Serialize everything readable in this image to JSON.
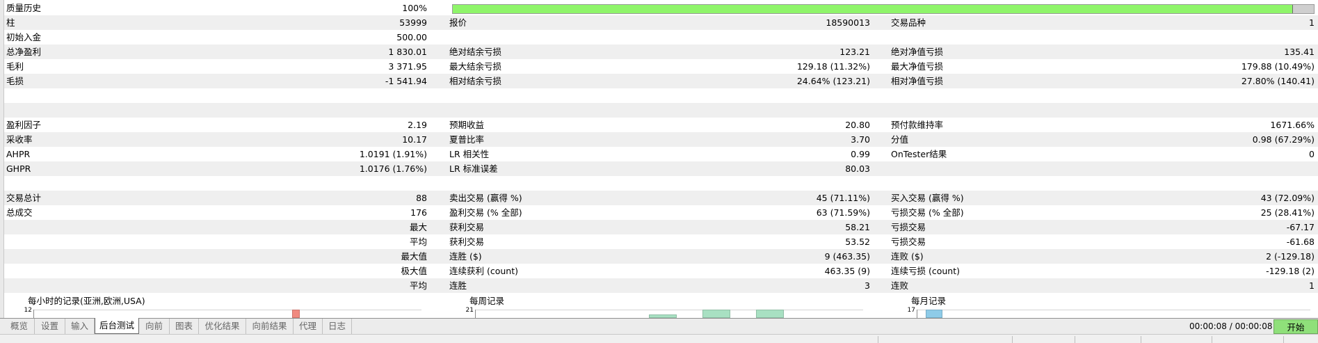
{
  "quality_row": {
    "label": "质量历史",
    "value": "100%",
    "progress": 0.976
  },
  "rows": [
    {
      "l1": "柱",
      "v1": "53999",
      "l2": "报价",
      "v2": "18590013",
      "l3": "交易品种",
      "v3": "1",
      "shade": true
    },
    {
      "l1": "初始入金",
      "v1": "500.00",
      "l2": "",
      "v2": "",
      "l3": "",
      "v3": "",
      "shade": false
    },
    {
      "l1": "总净盈利",
      "v1": "1 830.01",
      "l2": "绝对结余亏损",
      "v2": "123.21",
      "l3": "绝对净值亏损",
      "v3": "135.41",
      "shade": true
    },
    {
      "l1": "毛利",
      "v1": "3 371.95",
      "l2": "最大结余亏损",
      "v2": "129.18 (11.32%)",
      "l3": "最大净值亏损",
      "v3": "179.88 (10.49%)",
      "shade": false
    },
    {
      "l1": "毛损",
      "v1": "-1 541.94",
      "l2": "相对结余亏损",
      "v2": "24.64% (123.21)",
      "l3": "相对净值亏损",
      "v3": "27.80% (140.41)",
      "shade": true
    },
    {
      "l1": "",
      "v1": "",
      "l2": "",
      "v2": "",
      "l3": "",
      "v3": "",
      "shade": false
    },
    {
      "l1": "",
      "v1": "",
      "l2": "",
      "v2": "",
      "l3": "",
      "v3": "",
      "shade": true
    },
    {
      "l1": "盈利因子",
      "v1": "2.19",
      "l2": "预期收益",
      "v2": "20.80",
      "l3": "预付款维持率",
      "v3": "1671.66%",
      "shade": false
    },
    {
      "l1": "采收率",
      "v1": "10.17",
      "l2": "夏普比率",
      "v2": "3.70",
      "l3": "分值",
      "v3": "0.98 (67.29%)",
      "shade": true
    },
    {
      "l1": "AHPR",
      "v1": "1.0191 (1.91%)",
      "l2": "LR 相关性",
      "v2": "0.99",
      "l3": "OnTester结果",
      "v3": "0",
      "shade": false
    },
    {
      "l1": "GHPR",
      "v1": "1.0176 (1.76%)",
      "l2": "LR 标准误差",
      "v2": "80.03",
      "l3": "",
      "v3": "",
      "shade": true
    },
    {
      "l1": "",
      "v1": "",
      "l2": "",
      "v2": "",
      "l3": "",
      "v3": "",
      "shade": false
    },
    {
      "l1": "交易总计",
      "v1": "88",
      "l2": "卖出交易 (赢得 %)",
      "v2": "45 (71.11%)",
      "l3": "买入交易 (赢得 %)",
      "v3": "43 (72.09%)",
      "shade": true
    },
    {
      "l1": "总成交",
      "v1": "176",
      "l2": "盈利交易 (% 全部)",
      "v2": "63 (71.59%)",
      "l3": "亏损交易 (% 全部)",
      "v3": "25 (28.41%)",
      "shade": false
    },
    {
      "l1": "",
      "v1": "最大",
      "l2": "获利交易",
      "v2": "58.21",
      "l3": "亏损交易",
      "v3": "-67.17",
      "shade": true
    },
    {
      "l1": "",
      "v1": "平均",
      "l2": "获利交易",
      "v2": "53.52",
      "l3": "亏损交易",
      "v3": "-61.68",
      "shade": false
    },
    {
      "l1": "",
      "v1": "最大值",
      "l2": "连胜 ($)",
      "v2": "9 (463.35)",
      "l3": "连败 ($)",
      "v3": "2 (-129.18)",
      "shade": true
    },
    {
      "l1": "",
      "v1": "极大值",
      "l2": "连续获利 (count)",
      "v2": "463.35 (9)",
      "l3": "连续亏损 (count)",
      "v3": "-129.18 (2)",
      "shade": false
    },
    {
      "l1": "",
      "v1": "平均",
      "l2": "连胜",
      "v2": "3",
      "l3": "连败",
      "v3": "1",
      "shade": true
    },
    {
      "l1": "",
      "v1": "",
      "l2": "",
      "v2": "",
      "l3": "",
      "v3": "",
      "shade": false
    }
  ],
  "charts": [
    {
      "title": "每小时的记录(亚洲,欧洲,USA)",
      "ytick": "12",
      "bar_color": "#f08a80"
    },
    {
      "title": "每周记录",
      "ytick": "21",
      "bar_color": "#a8e0c2"
    },
    {
      "title": "每月记录",
      "ytick": "17",
      "bar_color": "#8ecbe8"
    }
  ],
  "tabs": [
    "概览",
    "设置",
    "输入",
    "后台测试",
    "向前",
    "图表",
    "优化结果",
    "向前结果",
    "代理",
    "日志"
  ],
  "active_tab": "后台测试",
  "timer": "00:00:08 / 00:00:08",
  "start_button": "开始",
  "colors": {
    "quality_fill": "#8ff56a",
    "start_button": "#8fe07a",
    "row_shade": "#efefef"
  }
}
